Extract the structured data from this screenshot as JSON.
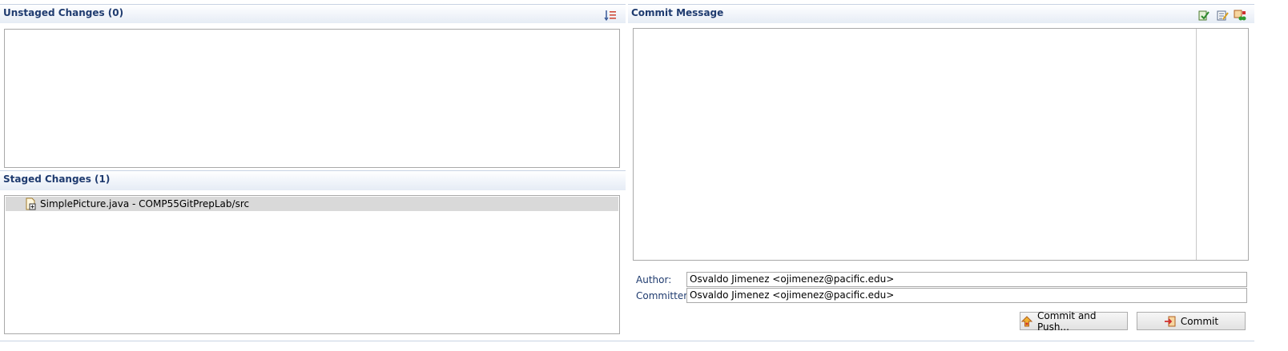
{
  "unstaged": {
    "title": "Unstaged Changes (0)",
    "sort_icon": "sort-list-icon"
  },
  "staged": {
    "title": "Staged Changes (1)",
    "files": [
      {
        "name": "SimplePicture.java - COMP55GitPrepLab/src",
        "icon": "java-file-staged-icon"
      }
    ]
  },
  "commit": {
    "title": "Commit Message",
    "message": "",
    "toolbar_icons": [
      "signed-off-icon",
      "amend-icon",
      "compare-icon"
    ],
    "author_label": "Author:",
    "author_value": "Osvaldo Jimenez <ojimenez@pacific.edu>",
    "committer_label": "Committer:",
    "committer_value": "Osvaldo Jimenez <ojimenez@pacific.edu>",
    "commit_and_push_label": "Commit and Push...",
    "commit_label": "Commit"
  }
}
